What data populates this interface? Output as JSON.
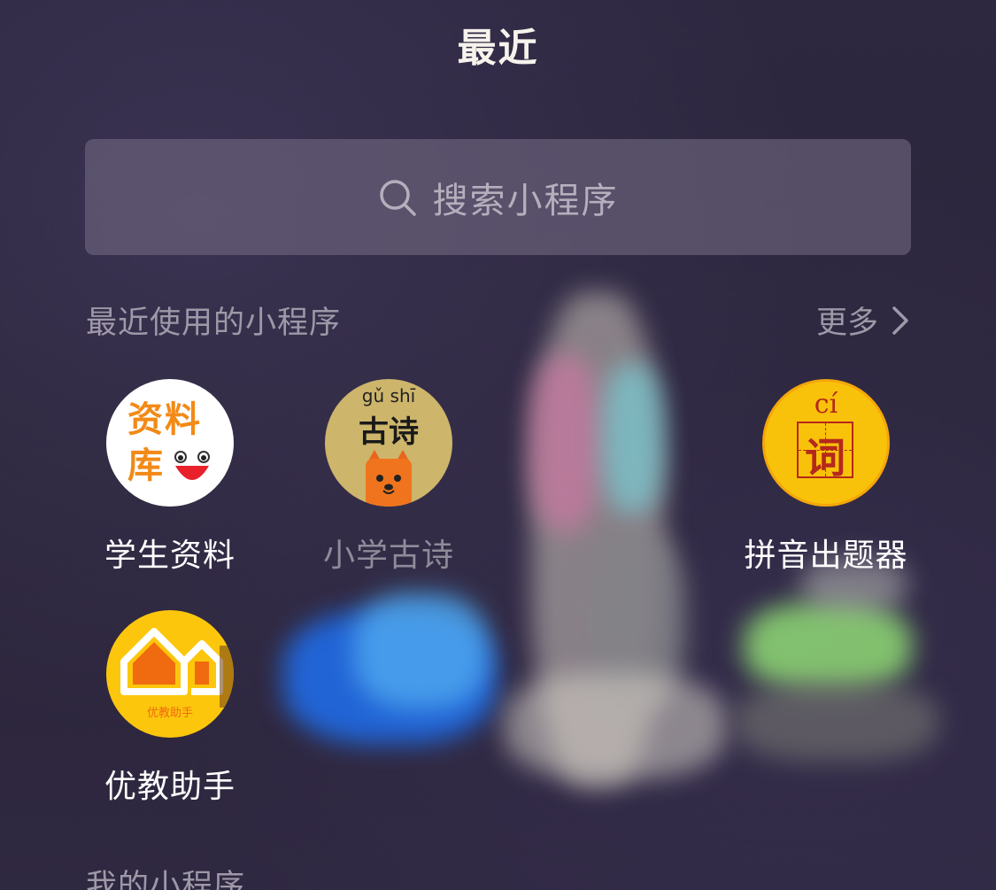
{
  "header": {
    "title": "最近"
  },
  "search": {
    "placeholder": "搜索小程序",
    "icon": "search-icon"
  },
  "recent": {
    "title": "最近使用的小程序",
    "more_label": "更多",
    "apps": [
      {
        "name": "学生资料",
        "icon_text": [
          "资料",
          "库"
        ]
      },
      {
        "name": "小学古诗",
        "icon_pinyin": "gǔ shī",
        "icon_text": "古诗"
      },
      {
        "name": "拼音出题器",
        "icon_pinyin": "cí",
        "icon_text": "词"
      },
      {
        "name": "优教助手",
        "icon_text": "优教助手"
      }
    ]
  },
  "mine": {
    "title": "我的小程序"
  },
  "colors": {
    "background": "#2a2438",
    "search_bg": "#6d677a",
    "accent_orange": "#f28a17",
    "accent_yellow": "#f8c20a",
    "muted_text": "#9e98a8"
  }
}
